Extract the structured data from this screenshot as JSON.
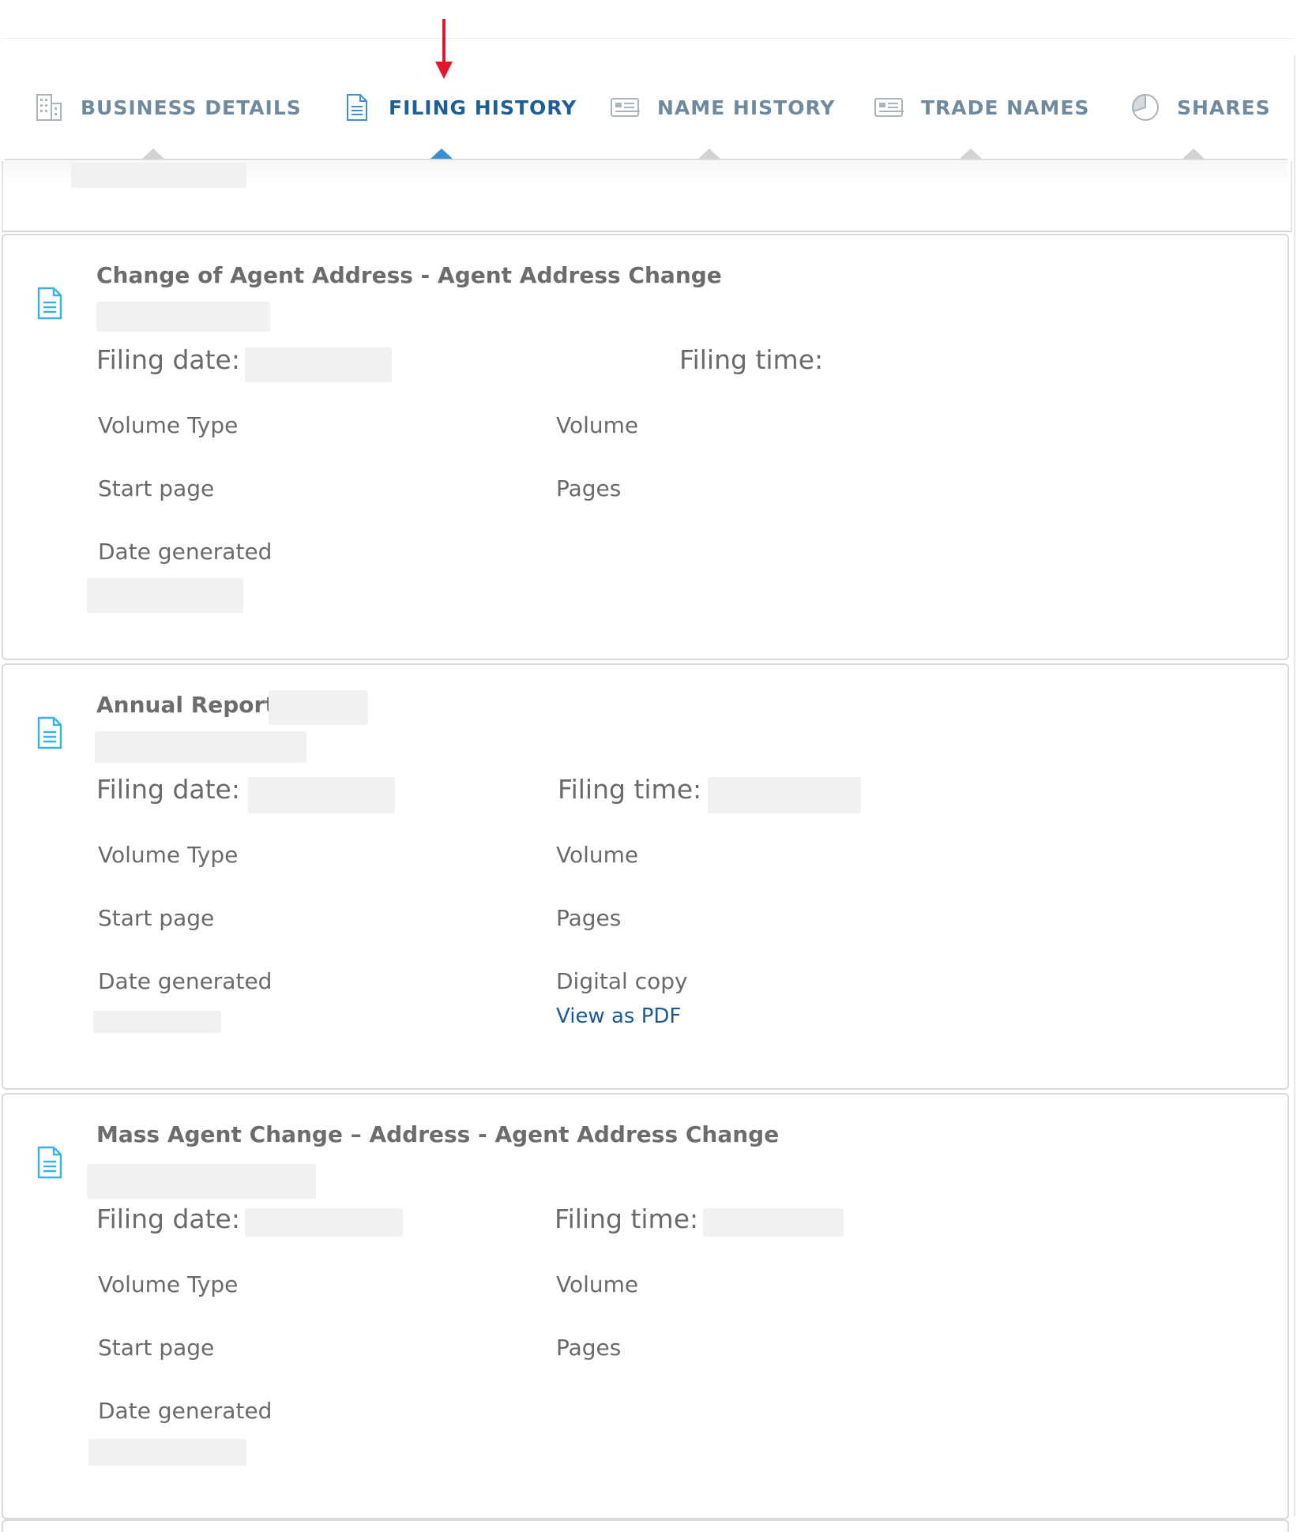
{
  "tabs": [
    {
      "label": "BUSINESS DETAILS",
      "icon": "building-icon"
    },
    {
      "label": "FILING HISTORY",
      "icon": "document-icon",
      "active": true
    },
    {
      "label": "NAME HISTORY",
      "icon": "id-card-icon"
    },
    {
      "label": "TRADE NAMES",
      "icon": "id-card-icon"
    },
    {
      "label": "SHARES",
      "icon": "pie-chart-icon"
    }
  ],
  "colors": {
    "tab_text": "#6f8a9e",
    "tab_active_text": "#1f5f96",
    "tab_active_pointer": "#3d8fd3",
    "annotation_arrow": "#e0162b",
    "link": "#1c5a92",
    "doc_icon": "#3fb0e3"
  },
  "filings": [
    {
      "title": "Change of Agent Address - Agent Address Change",
      "filing_date_label": "Filing date:",
      "filing_time_label": "Filing time:",
      "volume_type_label": "Volume Type",
      "volume_label": "Volume",
      "start_page_label": "Start page",
      "pages_label": "Pages",
      "date_generated_label": "Date generated"
    },
    {
      "title": "Annual Report",
      "filing_date_label": "Filing date:",
      "filing_time_label": "Filing time:",
      "volume_type_label": "Volume Type",
      "volume_label": "Volume",
      "start_page_label": "Start page",
      "pages_label": "Pages",
      "date_generated_label": "Date generated",
      "digital_copy_label": "Digital copy",
      "view_pdf_link": "View as PDF"
    },
    {
      "title": "Mass Agent Change – Address - Agent Address Change",
      "filing_date_label": "Filing date:",
      "filing_time_label": "Filing time:",
      "volume_type_label": "Volume Type",
      "volume_label": "Volume",
      "start_page_label": "Start page",
      "pages_label": "Pages",
      "date_generated_label": "Date generated"
    }
  ]
}
